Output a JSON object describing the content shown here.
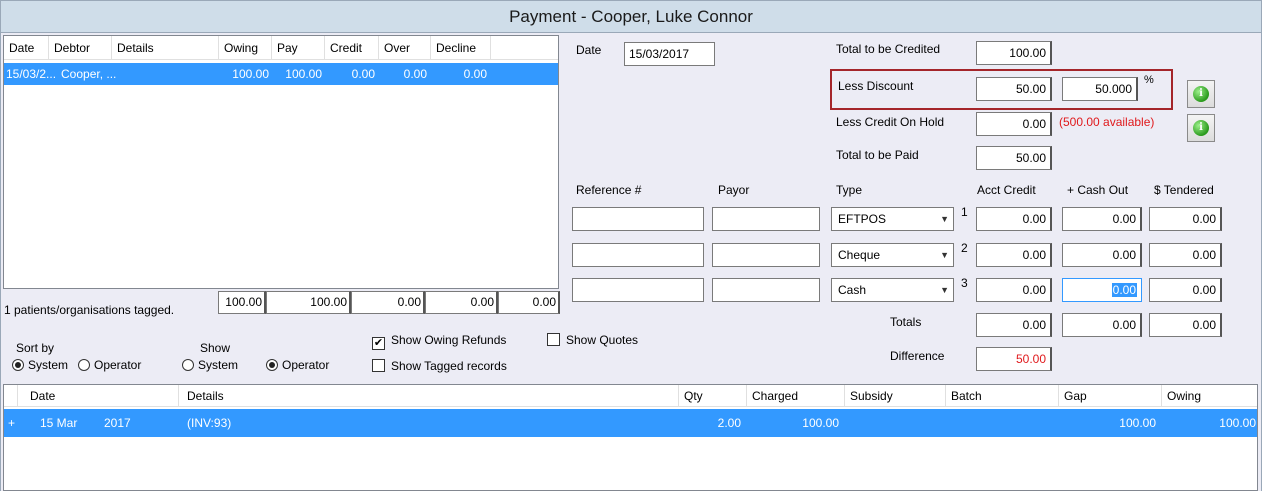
{
  "window": {
    "title": "Payment - Cooper, Luke Connor"
  },
  "upper_grid": {
    "columns": [
      "Date",
      "Debtor",
      "Details",
      "Owing",
      "Pay",
      "Credit",
      "Over",
      "Decline"
    ],
    "rows": [
      {
        "date": "15/03/2...",
        "debtor": "Cooper, ...",
        "details": "",
        "owing": "100.00",
        "pay": "100.00",
        "credit": "0.00",
        "over": "0.00",
        "decline": "0.00"
      }
    ]
  },
  "summary": {
    "tagged_text": "1 patients/organisations tagged.",
    "totals": [
      "100.00",
      "100.00",
      "0.00",
      "0.00",
      "0.00"
    ]
  },
  "sort_by": {
    "label": "Sort by",
    "options": [
      "System",
      "Operator"
    ],
    "selected": "System"
  },
  "show": {
    "label": "Show",
    "options": [
      "System",
      "Operator"
    ],
    "selected": "Operator"
  },
  "checkboxes": {
    "show_owing_refunds": {
      "label": "Show Owing Refunds",
      "checked": true
    },
    "show_tagged_records": {
      "label": "Show Tagged records",
      "checked": false
    },
    "show_quotes": {
      "label": "Show Quotes",
      "checked": false
    }
  },
  "date": {
    "label": "Date",
    "value": "15/03/2017"
  },
  "totals_panel": {
    "total_to_be_credited": {
      "label": "Total to be Credited",
      "value": "100.00"
    },
    "less_discount": {
      "label": "Less Discount",
      "value": "50.00",
      "percent": "50.000",
      "percent_sign": "%"
    },
    "less_credit_on_hold": {
      "label": "Less Credit On Hold",
      "value": "0.00",
      "available": "(500.00 available)"
    },
    "total_to_be_paid": {
      "label": "Total to be Paid",
      "value": "50.00"
    }
  },
  "payments": {
    "headers": [
      "Reference #",
      "Payor",
      "Type",
      "Acct Credit",
      "+ Cash Out",
      "$ Tendered"
    ],
    "rows": [
      {
        "reference": "",
        "payor": "",
        "type": "EFTPOS",
        "num": "1",
        "acct_credit": "0.00",
        "cash_out": "0.00",
        "tendered": "0.00"
      },
      {
        "reference": "",
        "payor": "",
        "type": "Cheque",
        "num": "2",
        "acct_credit": "0.00",
        "cash_out": "0.00",
        "tendered": "0.00"
      },
      {
        "reference": "",
        "payor": "",
        "type": "Cash",
        "num": "3",
        "acct_credit": "0.00",
        "cash_out": "0.00",
        "tendered": "0.00"
      }
    ],
    "totals": {
      "label": "Totals",
      "acct_credit": "0.00",
      "cash_out": "0.00",
      "tendered": "0.00"
    },
    "difference": {
      "label": "Difference",
      "value": "50.00"
    }
  },
  "lower_grid": {
    "columns": [
      "Date",
      "Details",
      "Qty",
      "Charged",
      "Subsidy",
      "Batch",
      "Gap",
      "Owing"
    ],
    "rows": [
      {
        "expander": "+",
        "day": "15 Mar",
        "year": "2017",
        "details": "(INV:93)",
        "qty": "2.00",
        "charged": "100.00",
        "subsidy": "",
        "batch": "",
        "gap": "100.00",
        "owing": "100.00"
      }
    ]
  },
  "colors": {
    "selection": "#3399ff",
    "highlight_frame": "#a4252a",
    "warning_text": "#e0191c"
  }
}
